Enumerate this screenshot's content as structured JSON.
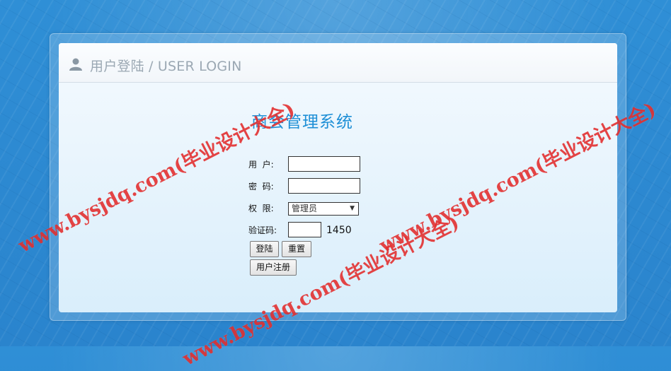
{
  "header": {
    "title": "用户登陆 / USER LOGIN"
  },
  "system": {
    "title": "商会管理系统"
  },
  "form": {
    "username_label": "用  户:",
    "username_value": "",
    "password_label": "密  码:",
    "password_value": "",
    "role_label": "权  限:",
    "role_selected": "管理员",
    "captcha_label": "验证码:",
    "captcha_value": "",
    "captcha_code": "1450"
  },
  "buttons": {
    "login": "登陆",
    "reset": "重置",
    "register": "用户注册"
  },
  "watermark": {
    "text": "www.bysjdq.com(毕业设计大全)"
  },
  "colors": {
    "accent": "#1e8fd6",
    "background": "#2d8ad2",
    "watermark": "#e02323"
  }
}
